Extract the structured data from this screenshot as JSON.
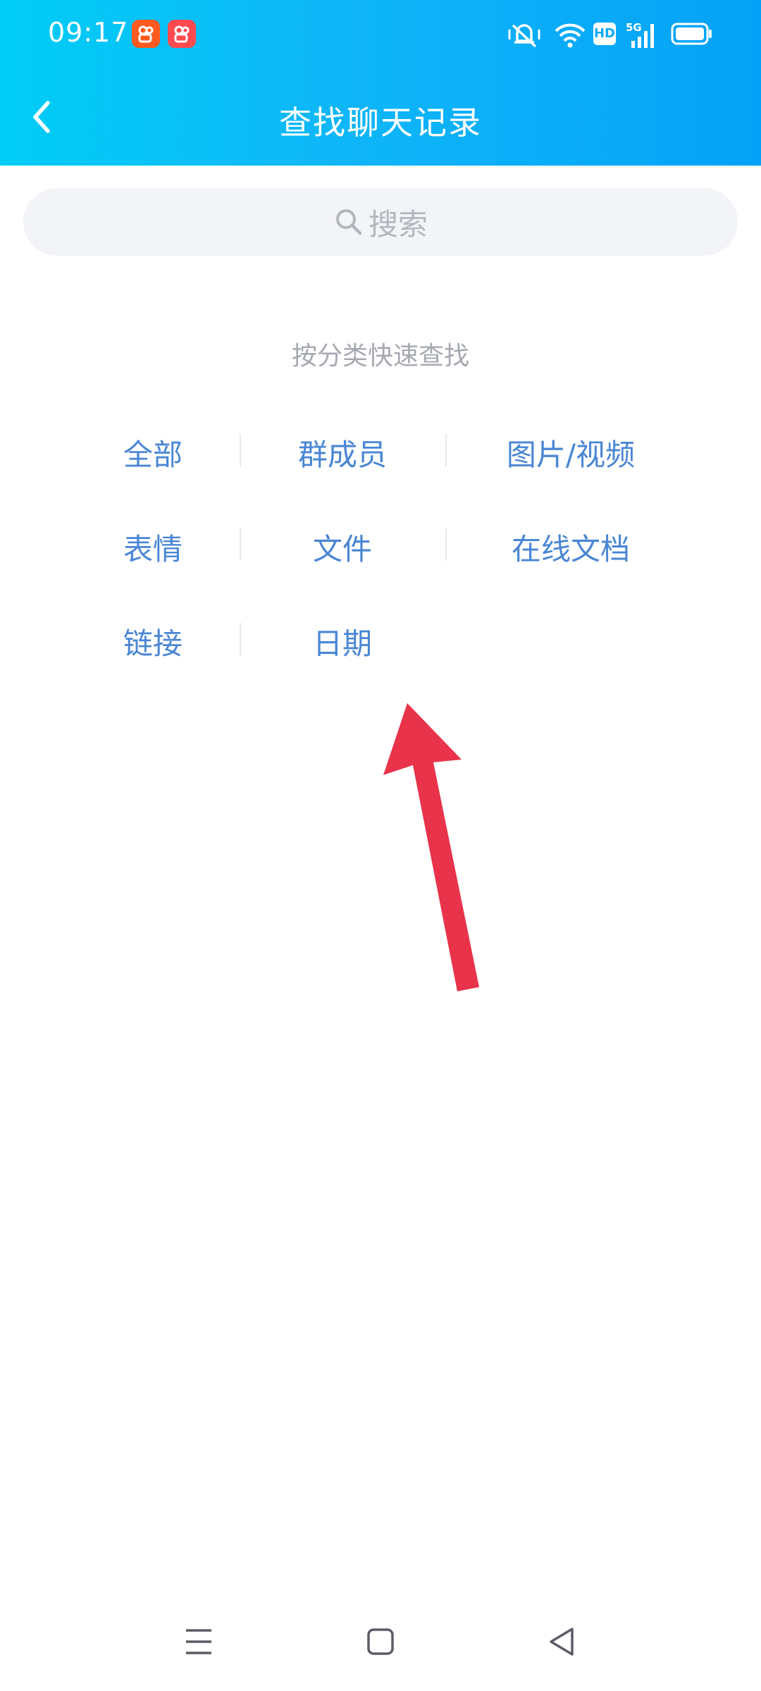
{
  "status_bar": {
    "time": "09:17",
    "icons": [
      "xiaohongshu-notification-icon",
      "kuaishou-notification-icon",
      "vibrate-mute-icon",
      "wifi-icon",
      "hd-icon",
      "5g-signal-icon",
      "battery-icon"
    ],
    "hd_text": "HD",
    "network_text": "5G"
  },
  "header": {
    "title": "查找聊天记录",
    "back_icon": "chevron-left-icon"
  },
  "search": {
    "placeholder": "搜索",
    "icon": "search-icon"
  },
  "categories": {
    "title": "按分类快速查找",
    "items": [
      {
        "label": "全部"
      },
      {
        "label": "群成员"
      },
      {
        "label": "图片/视频"
      },
      {
        "label": "表情"
      },
      {
        "label": "文件"
      },
      {
        "label": "在线文档"
      },
      {
        "label": "链接"
      },
      {
        "label": "日期"
      }
    ]
  },
  "annotation": {
    "icon": "red-arrow-icon",
    "color": "#e8334a"
  },
  "system_nav": {
    "items": [
      "menu-icon",
      "home-icon",
      "back-triangle-icon"
    ]
  },
  "colors": {
    "header_start": "#00cdf6",
    "header_end": "#05a2f7",
    "link_blue": "#4a86d4",
    "muted_gray": "#a6a9b0"
  }
}
